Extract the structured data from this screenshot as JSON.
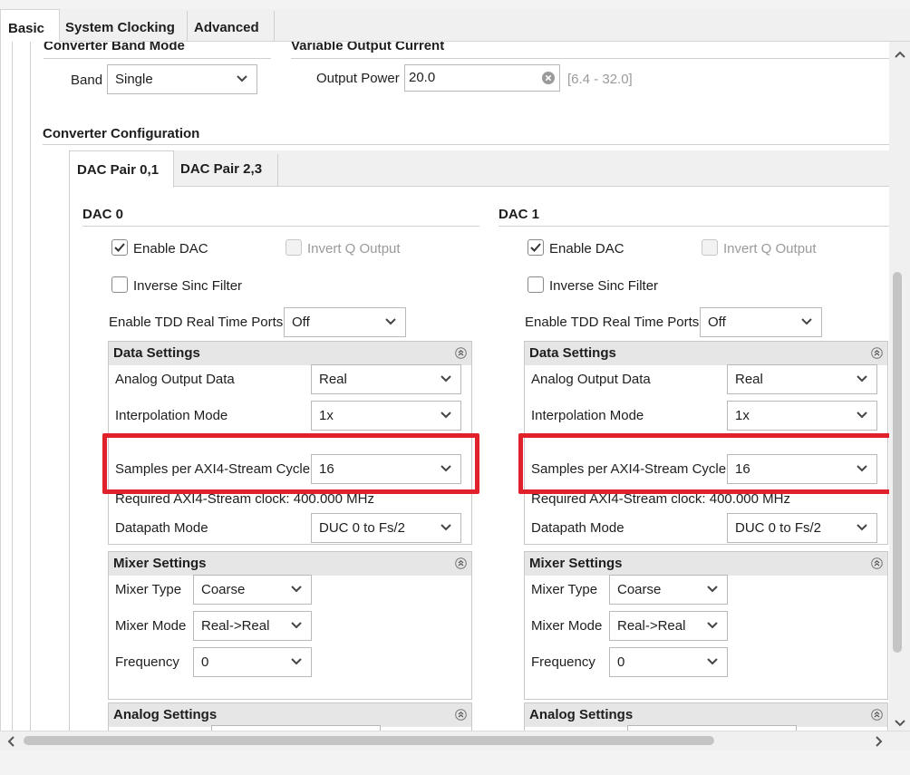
{
  "top_tabs": [
    "Basic",
    "System Clocking",
    "Advanced"
  ],
  "band_mode": {
    "title": "Converter Band Mode",
    "band_label": "Band",
    "band_value": "Single"
  },
  "output_current": {
    "title": "Variable Output Current",
    "power_label": "Output Power",
    "power_value": "20.0",
    "power_range": "[6.4 - 32.0]"
  },
  "config_title": "Converter Configuration",
  "dac_tabs": [
    "DAC Pair 0,1",
    "DAC Pair 2,3"
  ],
  "dacs": [
    {
      "title": "DAC 0",
      "enable_dac": "Enable DAC",
      "invert_q": "Invert Q Output",
      "inverse_sinc": "Inverse Sinc Filter",
      "tdd_label": "Enable TDD Real Time Ports",
      "tdd_value": "Off",
      "data_settings": {
        "title": "Data Settings",
        "analog_output_label": "Analog Output Data",
        "analog_output_value": "Real",
        "interp_label": "Interpolation Mode",
        "interp_value": "1x",
        "samples_label": "Samples per AXI4-Stream Cycle",
        "samples_value": "16",
        "clock_text": "Required AXI4-Stream clock: 400.000 MHz",
        "datapath_label": "Datapath Mode",
        "datapath_value": "DUC 0 to Fs/2"
      },
      "mixer_settings": {
        "title": "Mixer Settings",
        "type_label": "Mixer Type",
        "type_value": "Coarse",
        "mode_label": "Mixer Mode",
        "mode_value": "Real->Real",
        "freq_label": "Frequency",
        "freq_value": "0"
      },
      "analog_settings": {
        "title": "Analog Settings"
      }
    },
    {
      "title": "DAC 1",
      "enable_dac": "Enable DAC",
      "invert_q": "Invert Q Output",
      "inverse_sinc": "Inverse Sinc Filter",
      "tdd_label": "Enable TDD Real Time Ports",
      "tdd_value": "Off",
      "data_settings": {
        "title": "Data Settings",
        "analog_output_label": "Analog Output Data",
        "analog_output_value": "Real",
        "interp_label": "Interpolation Mode",
        "interp_value": "1x",
        "samples_label": "Samples per AXI4-Stream Cycle",
        "samples_value": "16",
        "clock_text": "Required AXI4-Stream clock: 400.000 MHz",
        "datapath_label": "Datapath Mode",
        "datapath_value": "DUC 0 to Fs/2"
      },
      "mixer_settings": {
        "title": "Mixer Settings",
        "type_label": "Mixer Type",
        "type_value": "Coarse",
        "mode_label": "Mixer Mode",
        "mode_value": "Real->Real",
        "freq_label": "Frequency",
        "freq_value": "0"
      },
      "analog_settings": {
        "title": "Analog Settings"
      }
    }
  ],
  "colors": {
    "highlight": "#e0202a"
  }
}
